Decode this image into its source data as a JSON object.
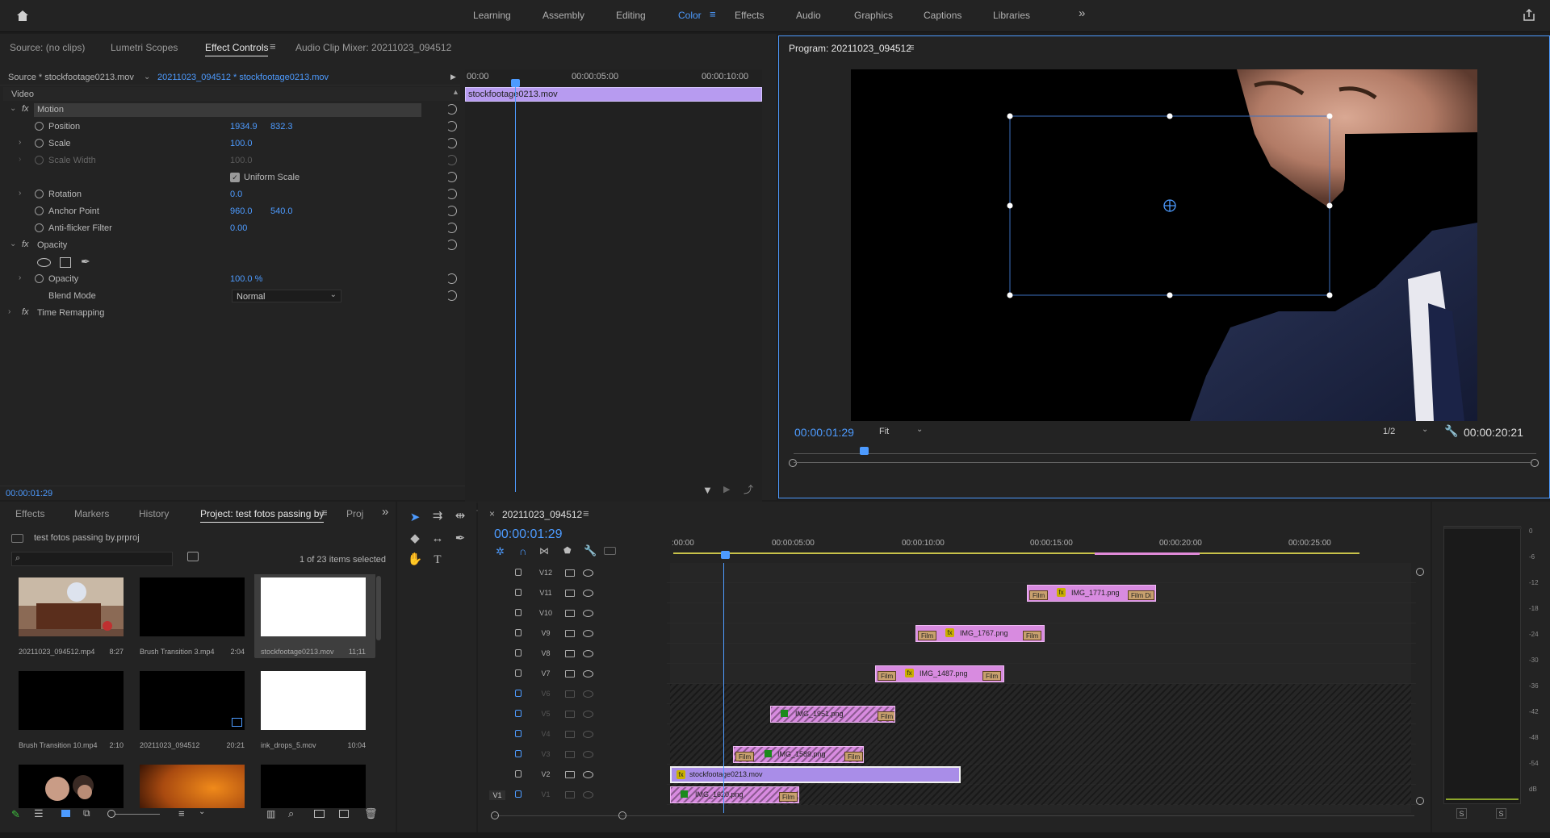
{
  "workspaces": {
    "items": [
      "Learning",
      "Assembly",
      "Editing",
      "Color",
      "Effects",
      "Audio",
      "Graphics",
      "Captions",
      "Libraries"
    ],
    "active": "Color",
    "more": "»"
  },
  "source_panel": {
    "tabs": [
      "Source: (no clips)",
      "Lumetri Scopes",
      "Effect Controls",
      "Audio Clip Mixer: 20211023_094512"
    ],
    "menu_glyph": "≡",
    "source_label": "Source * stockfootage0213.mov",
    "sequence_label": "20211023_094512 * stockfootage0213.mov",
    "mini_ruler": [
      "00:00",
      "00:00:05:00",
      "00:00:10:00"
    ],
    "mini_clip": "stockfootage0213.mov",
    "section_video": "Video",
    "effects": {
      "motion": "Motion",
      "position": {
        "label": "Position",
        "x": "1934.9",
        "y": "832.3"
      },
      "scale": {
        "label": "Scale",
        "value": "100.0"
      },
      "scale_width": {
        "label": "Scale Width",
        "value": "100.0"
      },
      "uniform_scale": "Uniform Scale",
      "rotation": {
        "label": "Rotation",
        "value": "0.0"
      },
      "anchor_point": {
        "label": "Anchor Point",
        "x": "960.0",
        "y": "540.0"
      },
      "anti_flicker": {
        "label": "Anti-flicker Filter",
        "value": "0.00"
      },
      "opacity_group": "Opacity",
      "opacity": {
        "label": "Opacity",
        "value": "100.0 %"
      },
      "blend_mode": {
        "label": "Blend Mode",
        "value": "Normal"
      },
      "time_remapping": "Time Remapping"
    },
    "timecode": "00:00:01:29"
  },
  "program_monitor": {
    "title": "Program: 20211023_094512",
    "menu_glyph": "≡",
    "timecode": "00:00:01:29",
    "fit": "Fit",
    "resolution": "1/2",
    "duration": "00:00:20:21",
    "add_glyph": "+"
  },
  "project_panel": {
    "tabs": [
      "Effects",
      "Markers",
      "History",
      "Project: test fotos passing by",
      "Proj"
    ],
    "menu_glyph": "≡",
    "more": "»",
    "project_file": "test fotos passing by.prproj",
    "selection_count": "1 of 23 items selected",
    "items": [
      {
        "name": "20211023_094512.mp4",
        "duration": "8:27",
        "kind": "room"
      },
      {
        "name": "Brush Transition 3.mp4",
        "duration": "2:04",
        "kind": "black"
      },
      {
        "name": "stockfootage0213.mov",
        "duration": "11;11",
        "kind": "white"
      },
      {
        "name": "Brush Transition 10.mp4",
        "duration": "2:10",
        "kind": "black"
      },
      {
        "name": "20211023_094512",
        "duration": "20:21",
        "kind": "black"
      },
      {
        "name": "ink_drops_5.mov",
        "duration": "10:04",
        "kind": "white"
      },
      {
        "name": "",
        "duration": "",
        "kind": "faces"
      },
      {
        "name": "",
        "duration": "",
        "kind": "orange"
      },
      {
        "name": "",
        "duration": "",
        "kind": "black"
      }
    ]
  },
  "timeline": {
    "sequence_name": "20211023_094512",
    "menu_glyph": "≡",
    "close_glyph": "×",
    "timecode": "00:00:01:29",
    "ruler": [
      ":00:00",
      "00:00:05:00",
      "00:00:10:00",
      "00:00:15:00",
      "00:00:20:00",
      "00:00:25:00"
    ],
    "tracks": [
      {
        "name": "V12",
        "dim": false,
        "clips": []
      },
      {
        "name": "V11",
        "dim": false,
        "clips": [
          {
            "name": "IMG_1771.png",
            "icon": "fx",
            "badges": [
              "Film",
              "Film Di"
            ]
          }
        ]
      },
      {
        "name": "V10",
        "dim": false,
        "clips": []
      },
      {
        "name": "V9",
        "dim": false,
        "clips": [
          {
            "name": "IMG_1767.png",
            "icon": "fx",
            "badges": [
              "Film",
              "Film"
            ]
          }
        ]
      },
      {
        "name": "V8",
        "dim": false,
        "clips": []
      },
      {
        "name": "V7",
        "dim": false,
        "clips": [
          {
            "name": "IMG_1487.png",
            "icon": "fx",
            "badges": [
              "Film",
              "Film"
            ]
          }
        ]
      },
      {
        "name": "V6",
        "dim": true,
        "clips": []
      },
      {
        "name": "V5",
        "dim": true,
        "clips": [
          {
            "name": "IMG_1951.png",
            "icon": "sq",
            "badges": [
              "",
              "Film"
            ]
          }
        ]
      },
      {
        "name": "V4",
        "dim": true,
        "clips": []
      },
      {
        "name": "V3",
        "dim": true,
        "clips": [
          {
            "name": "IMG_1589.png",
            "icon": "sq",
            "badges": [
              "Film",
              "Film"
            ]
          }
        ]
      },
      {
        "name": "V2",
        "dim": false,
        "clips": [
          {
            "name": "stockfootage0213.mov",
            "icon": "fx",
            "badges": []
          }
        ]
      },
      {
        "name": "V1",
        "dim": true,
        "target": "V1",
        "clips": [
          {
            "name": "IMG_1620.png",
            "icon": "sq",
            "badges": [
              "",
              "Film"
            ]
          }
        ]
      }
    ]
  },
  "audio_meter": {
    "scale": [
      "0",
      "-6",
      "-12",
      "-18",
      "-24",
      "-30",
      "-36",
      "-42",
      "-48",
      "-54",
      "dB"
    ],
    "solo": [
      "S",
      "S"
    ]
  },
  "colors": {
    "accent": "#4d9bff",
    "clip_pink": "#d88be0",
    "clip_violet": "#a98de8",
    "badge": "#c8a06e"
  }
}
